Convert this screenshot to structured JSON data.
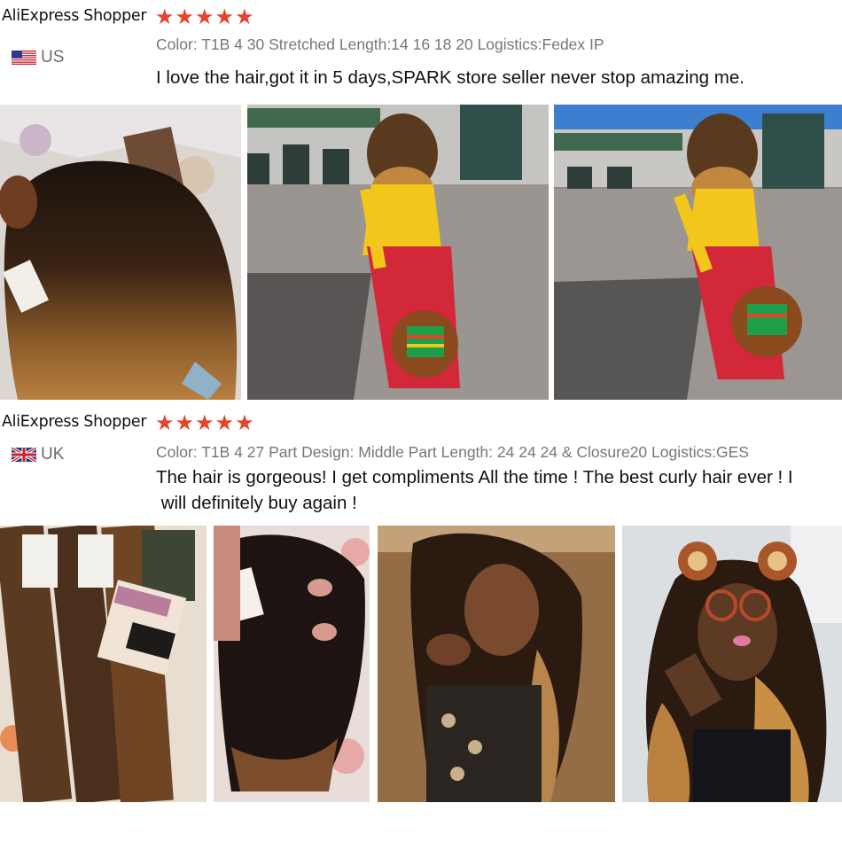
{
  "reviews": [
    {
      "reviewer": "AliExpress Shopper",
      "stars": [
        "★",
        "★",
        "★",
        "★",
        "★"
      ],
      "rating": 5,
      "country": "US",
      "flag": "us-flag-icon",
      "attributes": "Color: T1B 4 30 Stretched Length:14 16 18 20  Logistics:Fedex IP",
      "text": "I love the hair,got it in 5 days,SPARK store seller never stop amazing me."
    },
    {
      "reviewer": "AliExpress Shopper",
      "stars": [
        "★",
        "★",
        "★",
        "★",
        "★"
      ],
      "rating": 5,
      "country": "UK",
      "flag": "uk-flag-icon",
      "attributes": "Color: T1B 4 27 Part Design: Middle Part Length: 24 24 24 & Closure20 Logistics:GES",
      "text_line1": "The hair is gorgeous! I get compliments All the time ! The best curly hair ever ! I",
      "text_line2": " will definitely buy again !"
    }
  ],
  "colors": {
    "star": "#e5432a",
    "muted": "#777777",
    "text": "#111111"
  }
}
